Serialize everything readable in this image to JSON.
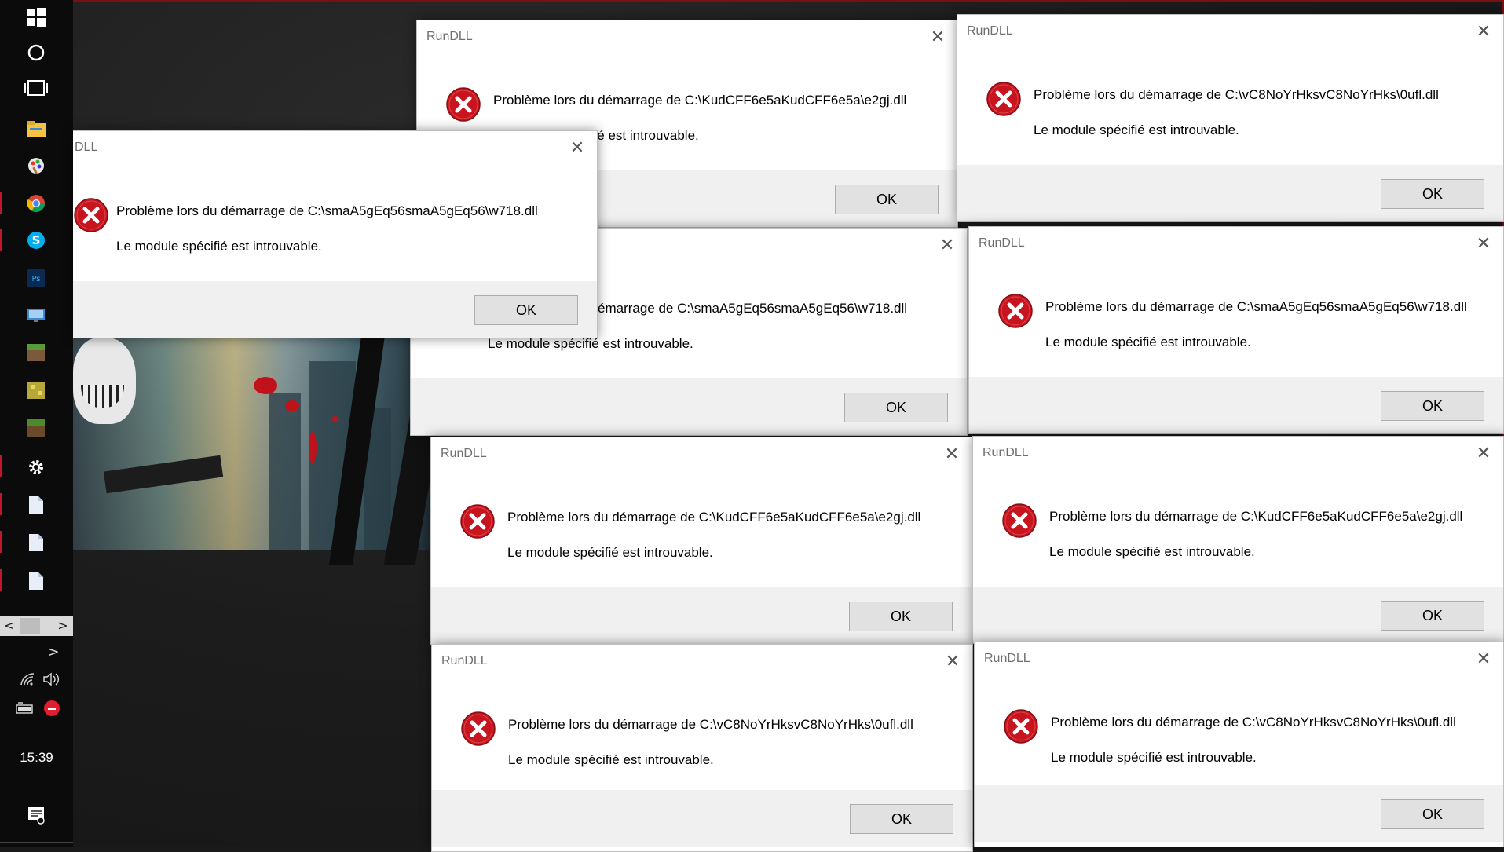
{
  "taskbar": {
    "icons": [
      "windows-start-icon",
      "cortana-circle-icon",
      "task-view-icon",
      "file-explorer-icon",
      "paint-icon",
      "chrome-icon",
      "skype-icon",
      "photoshop-icon",
      "remote-desktop-icon",
      "minecraft-icon",
      "minecraft-alt-icon",
      "minecraft-server-icon",
      "settings-gear-icon",
      "document-icon",
      "document-icon",
      "document-icon"
    ],
    "scroll_left": "<",
    "scroll_right": ">",
    "overflow_chevron": ">",
    "clock": "15:39",
    "accent": "#c0182a"
  },
  "dialog": {
    "title": "RunDLL",
    "title_cut": "DLL",
    "close": "✕",
    "line2": "Le module spécifié est introuvable.",
    "ok": "OK",
    "line2_cut_top": "Le module spécifié est introuvable.",
    "line1_cut_left": "émarrage de C:\\smaA5gEq56smaA5gEq56\\w718.dll"
  },
  "dialogs": [
    {
      "id": "d1",
      "msg": "Problème lors du démarrage de C:\\KudCFF6e5aKudCFF6e5a\\e2gj.dll"
    },
    {
      "id": "d2",
      "msg": "Problème lors du démarrage de C:\\vC8NoYrHksvC8NoYrHks\\0ufl.dll"
    },
    {
      "id": "d3",
      "msg": "Problème lors du démarrage de C:\\smaA5gEq56smaA5gEq56\\w718.dll"
    },
    {
      "id": "d4",
      "msg": "Problème lors du démarrage de C:\\smaA5gEq56smaA5gEq56\\w718.dll"
    },
    {
      "id": "d5",
      "msg": "Problème lors du démarrage de C:\\smaA5gEq56smaA5gEq56\\w718.dll"
    },
    {
      "id": "d6",
      "msg": "Problème lors du démarrage de C:\\KudCFF6e5aKudCFF6e5a\\e2gj.dll"
    },
    {
      "id": "d7",
      "msg": "Problème lors du démarrage de C:\\KudCFF6e5aKudCFF6e5a\\e2gj.dll"
    },
    {
      "id": "d8",
      "msg": "Problème lors du démarrage de C:\\vC8NoYrHksvC8NoYrHks\\0ufl.dll"
    },
    {
      "id": "d9",
      "msg": "Problème lors du démarrage de C:\\vC8NoYrHksvC8NoYrHks\\0ufl.dll"
    }
  ]
}
